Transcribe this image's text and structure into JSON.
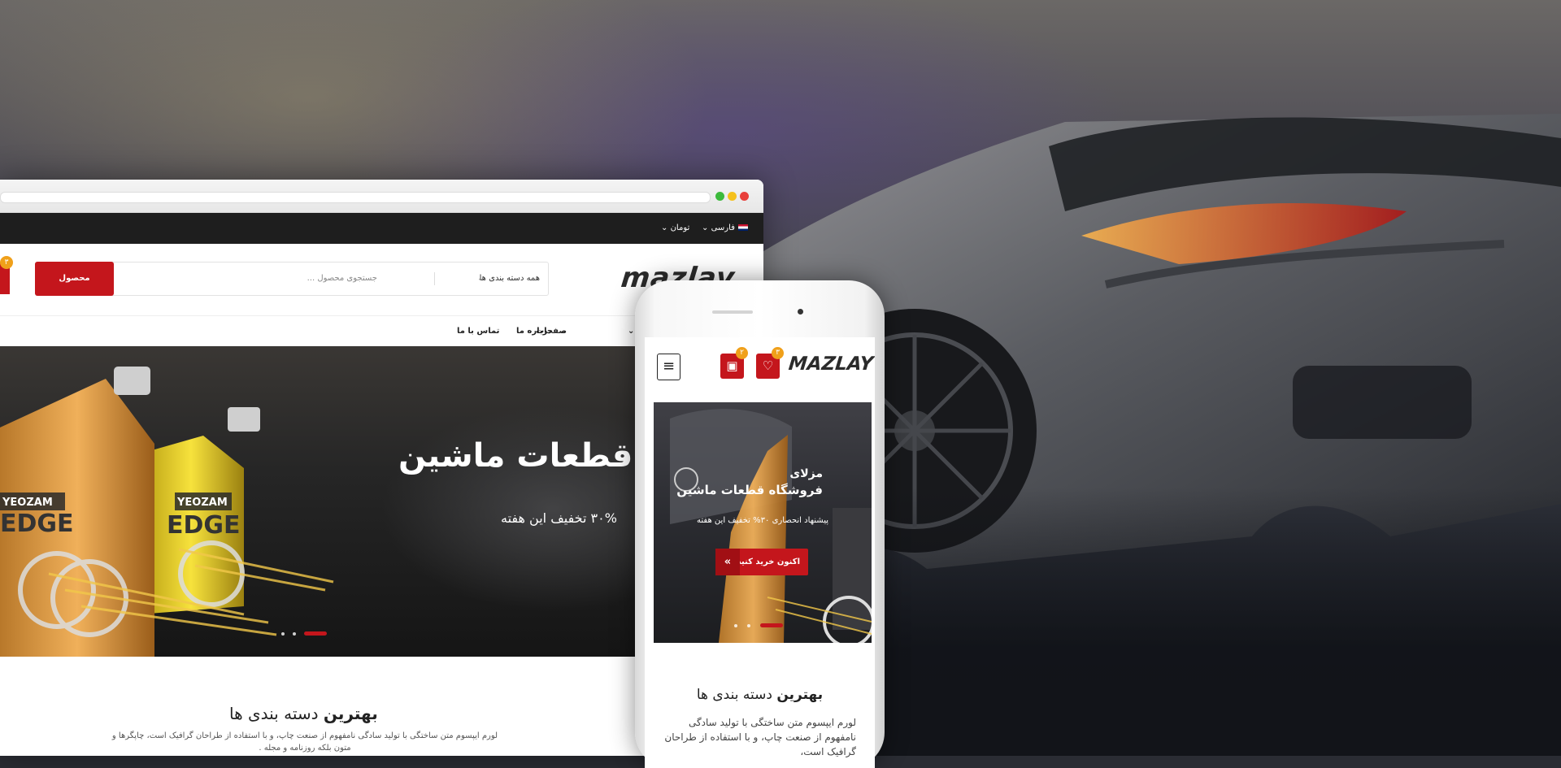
{
  "topbar": {
    "language": "فارسی",
    "currency": "تومان"
  },
  "header": {
    "logo": "mazlay",
    "search_placeholder": "جستجوی محصول ...",
    "category_select": "همه دسته بندی ها",
    "search_button": "محصول",
    "cart_badge": "۳"
  },
  "nav": {
    "items": [
      "تماس با ما",
      "درباره ما",
      "صفحات"
    ]
  },
  "hero": {
    "title": "ه قطعات ماشین",
    "subtitle": "۳۰% تخفیف این هفته",
    "bottle_label_1": "YEOZAM",
    "bottle_label_2": "YEOZAM",
    "bottle_text": "EDGE"
  },
  "section": {
    "title_bold": "بهترین",
    "title_rest": " دسته بندی ها",
    "text": "لورم ایپسوم متن ساختگی با تولید سادگی نامفهوم از صنعت چاپ، و با استفاده از طراحان گرافیک است، چاپگرها و متون بلکه روزنامه و مجله ."
  },
  "mobile": {
    "logo": "MAZLAY",
    "wishlist_badge": "۳",
    "cart_badge": "۲",
    "hero_line1": "مزلای",
    "hero_line2": "فروشگاه قطعات ماشین",
    "hero_line3": "پیشنهاد انحصاری ۳۰% تخفیف این هفته",
    "hero_cta": "اکنون خرید کنید",
    "section_title_bold": "بهترین",
    "section_title_rest": " دسته بندی ها",
    "section_text": "لورم ایپسوم متن ساختگی با تولید سادگی نامفهوم از صنعت چاپ، و با استفاده از طراحان گرافیک است،"
  },
  "colors": {
    "accent": "#c4161c",
    "badge": "#f0a01a",
    "topbar": "#1e1e1e"
  },
  "icons": [
    "heart-icon",
    "cart-icon",
    "menu-icon",
    "chevron-down-icon",
    "double-arrow-icon",
    "flag-icon"
  ]
}
